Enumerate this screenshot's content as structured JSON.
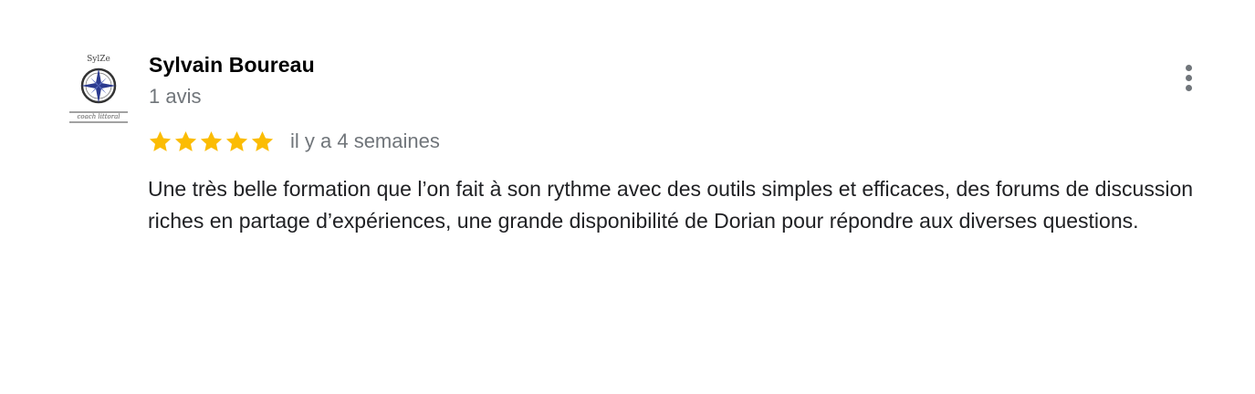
{
  "review": {
    "reviewer_name": "Sylvain Boureau",
    "reviewer_review_count": "1 avis",
    "avatar_icon": "compass-rose-logo-icon",
    "avatar_logo_text_top": "SylZe",
    "avatar_logo_text_bottom": "coach littoral",
    "rating": {
      "value": 5,
      "max": 5,
      "star_color": "#fbbc04"
    },
    "date": "il y a 4 semaines",
    "text": "Une très belle formation que l’on fait à son rythme avec des outils simples et efficaces, des forums de discussion riches en partage d’expériences, une grande disponibilité de Dorian pour répondre aux diverses questions.",
    "menu_icon": "more-vert-icon"
  },
  "colors": {
    "name": "#000000",
    "secondary_text": "#70757a",
    "body_text": "#202124"
  }
}
